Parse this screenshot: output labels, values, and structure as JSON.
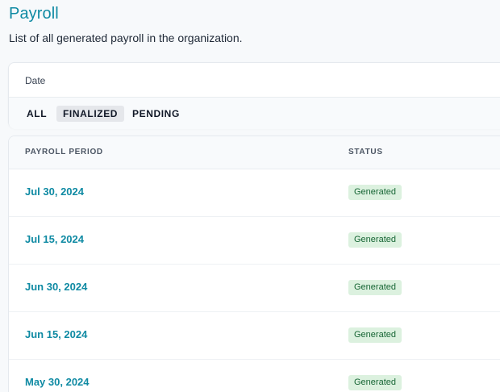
{
  "header": {
    "title": "Payroll",
    "subtitle": "List of all generated payroll in the organization."
  },
  "filters": {
    "date_label": "Date",
    "tabs": [
      {
        "label": "ALL",
        "active": false
      },
      {
        "label": "FINALIZED",
        "active": true
      },
      {
        "label": "PENDING",
        "active": false
      }
    ]
  },
  "table": {
    "columns": [
      "PAYROLL PERIOD",
      "STATUS"
    ],
    "rows": [
      {
        "period": "Jul 30, 2024",
        "status": "Generated"
      },
      {
        "period": "Jul 15, 2024",
        "status": "Generated"
      },
      {
        "period": "Jun 30, 2024",
        "status": "Generated"
      },
      {
        "period": "Jun 15, 2024",
        "status": "Generated"
      },
      {
        "period": "May 30, 2024",
        "status": "Generated"
      }
    ]
  },
  "colors": {
    "accent": "#0f8aa3",
    "badge_bg": "#dcf1df",
    "badge_text": "#166534"
  }
}
